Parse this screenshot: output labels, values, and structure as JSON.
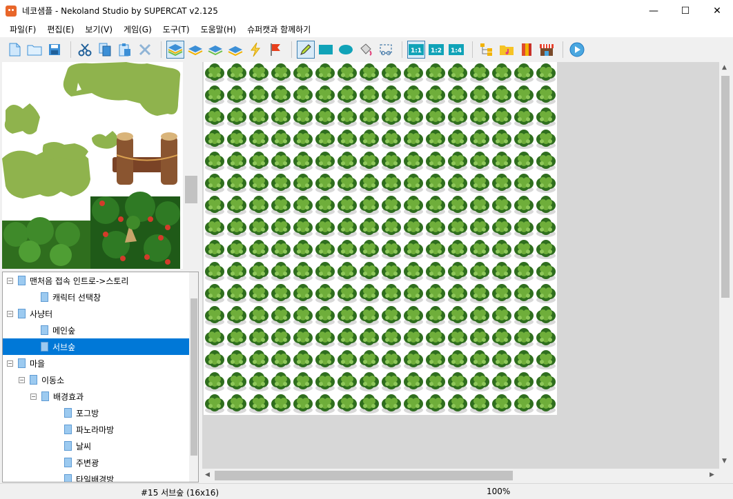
{
  "window": {
    "title": "네코샘플 - Nekoland Studio by SUPERCAT v2.125",
    "minimize_glyph": "—",
    "maximize_glyph": "☐",
    "close_glyph": "✕"
  },
  "menu": [
    {
      "label": "파일(F)"
    },
    {
      "label": "편집(E)"
    },
    {
      "label": "보기(V)"
    },
    {
      "label": "게임(G)"
    },
    {
      "label": "도구(T)"
    },
    {
      "label": "도움말(H)"
    },
    {
      "label": "슈퍼캣과 함께하기"
    }
  ],
  "toolbar": {
    "icons": [
      "new-file-icon",
      "open-folder-icon",
      "save-icon",
      "cut-icon",
      "copy-icon",
      "paste-icon",
      "delete-icon",
      "layer-1-icon",
      "layer-2-icon",
      "layer-3-icon",
      "layer-4-icon",
      "lightning-icon",
      "flag-icon",
      "pencil-icon",
      "rectangle-icon",
      "ellipse-icon",
      "fill-icon",
      "select-icon",
      "zoom-1-1-icon",
      "zoom-1-2-icon",
      "zoom-1-4-icon",
      "tree-icon",
      "music-folder-icon",
      "book-icon",
      "shop-icon",
      "play-icon"
    ],
    "zoom_labels": [
      "1:1",
      "1:2",
      "1:4"
    ]
  },
  "tree": [
    {
      "label": "맨처음 접속 인트로->스토리",
      "level": 0,
      "expander": "⊟"
    },
    {
      "label": "캐릭터 선택창",
      "level": 1,
      "expander": ""
    },
    {
      "label": "사냥터",
      "level": 0,
      "expander": "⊟"
    },
    {
      "label": "메인숲",
      "level": 1,
      "expander": ""
    },
    {
      "label": "서브숲",
      "level": 1,
      "expander": "",
      "selected": true
    },
    {
      "label": "마을",
      "level": 0,
      "expander": "⊟"
    },
    {
      "label": "이동소",
      "level": 1,
      "expander": "⊟"
    },
    {
      "label": "배경효과",
      "level": 2,
      "expander": "⊟"
    },
    {
      "label": "포그방",
      "level": 3,
      "expander": ""
    },
    {
      "label": "파노라마방",
      "level": 3,
      "expander": ""
    },
    {
      "label": "날씨",
      "level": 3,
      "expander": ""
    },
    {
      "label": "주변광",
      "level": 3,
      "expander": ""
    },
    {
      "label": "타일배경방",
      "level": 3,
      "expander": ""
    }
  ],
  "map": {
    "columns": 16,
    "rows": 16,
    "tile": "bush-tile"
  },
  "status": {
    "map_info": "#15 서브숲 (16x16)",
    "zoom": "100%"
  },
  "colors": {
    "accent": "#0078d7",
    "grass": "#8fb34d",
    "bush_dark": "#2f6e1e",
    "bush_light": "#6fae3a"
  }
}
